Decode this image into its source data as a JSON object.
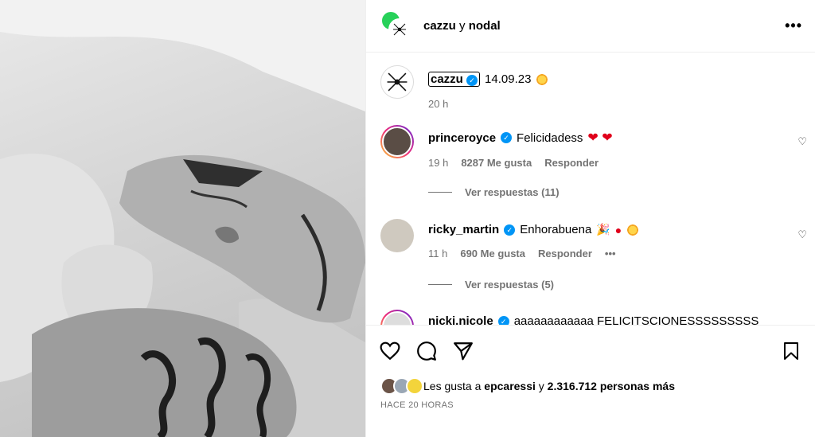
{
  "header": {
    "title_main": "cazzu",
    "title_join": "y",
    "title_second": "nodal",
    "more_label": "•••"
  },
  "caption": {
    "username": "cazzu",
    "text": "14.09.23",
    "time": "20 h"
  },
  "comments": [
    {
      "username": "princeroyce",
      "text": "Felicidadess",
      "emojis": "❤ ❤",
      "time": "19 h",
      "likes": "8287 Me gusta",
      "reply_label": "Responder",
      "view_replies": "Ver respuestas (11)"
    },
    {
      "username": "ricky_martin",
      "text": "Enhorabuena",
      "time": "11 h",
      "likes": "690 Me gusta",
      "reply_label": "Responder",
      "more_label": "•••",
      "view_replies": "Ver respuestas (5)"
    },
    {
      "username": "nicki.nicole",
      "text": "aaaaaaaaaaaa FELICITSCIONESSSSSSSSS"
    }
  ],
  "likes": {
    "prefix": "Les gusta a",
    "user": "epcaressi",
    "join": "y",
    "count": "2.316.712 personas más"
  },
  "timestamp": "HACE 20 HORAS",
  "colors": {
    "verified": "#0095f6",
    "muted": "#737373",
    "heart": "#e0001a"
  }
}
